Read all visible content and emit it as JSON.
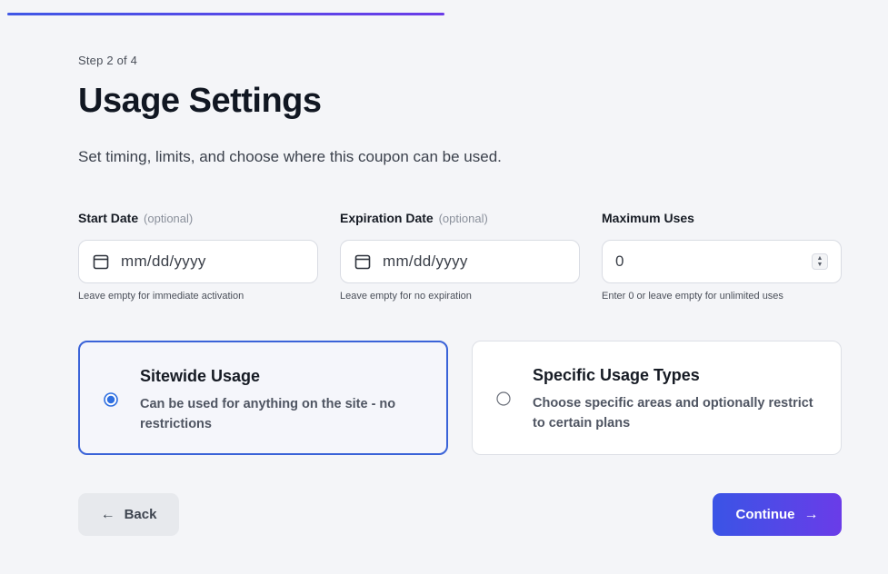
{
  "progress": {
    "fraction": 0.5,
    "color_start": "#3f57e6",
    "color_end": "#6a3be8"
  },
  "step_label": "Step 2 of 4",
  "title": "Usage Settings",
  "subtitle": "Set timing, limits, and choose where this coupon can be used.",
  "fields": {
    "start_date": {
      "label": "Start Date",
      "optional": "(optional)",
      "placeholder": "mm/dd/yyyy",
      "icon": "calendar-icon",
      "help": "Leave empty for immediate activation"
    },
    "expiration_date": {
      "label": "Expiration Date",
      "optional": "(optional)",
      "placeholder": "mm/dd/yyyy",
      "icon": "calendar-icon",
      "help": "Leave empty for no expiration"
    },
    "maximum_uses": {
      "label": "Maximum Uses",
      "value": "0",
      "help": "Enter 0 or leave empty for unlimited uses"
    }
  },
  "usage_options": [
    {
      "title": "Sitewide Usage",
      "description": "Can be used for anything on the site - no restrictions",
      "selected": true
    },
    {
      "title": "Specific Usage Types",
      "description": "Choose specific areas and optionally restrict to certain plans",
      "selected": false
    }
  ],
  "buttons": {
    "back": {
      "label": "Back",
      "arrow": "←"
    },
    "continue": {
      "label": "Continue",
      "arrow": "→"
    }
  },
  "colors": {
    "accent": "#3a63d8",
    "background": "#f4f5f8"
  }
}
